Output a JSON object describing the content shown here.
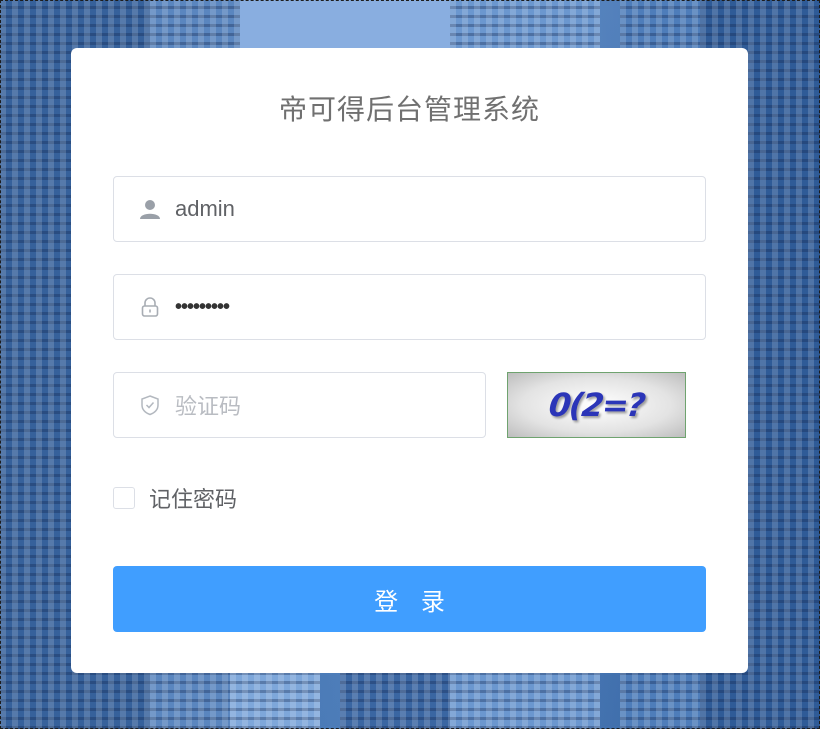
{
  "login": {
    "title": "帝可得后台管理系统",
    "username": {
      "value": "admin",
      "icon": "user-icon"
    },
    "password": {
      "masked_value": "•••••••••",
      "icon": "lock-icon"
    },
    "captcha_input": {
      "placeholder": "验证码",
      "icon": "shield-icon"
    },
    "captcha_image_text": "0(2=?",
    "remember_label": "记住密码",
    "remember_checked": false,
    "submit_label": "登 录"
  },
  "colors": {
    "primary": "#409eff",
    "card": "#ffffff",
    "border": "#dcdfe6",
    "captcha_text": "#2b35b8"
  }
}
